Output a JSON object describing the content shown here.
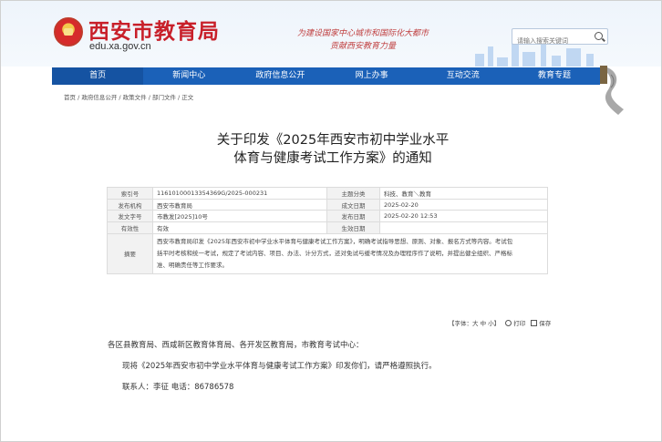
{
  "header": {
    "site_title": "西安市教育局",
    "site_domain": "edu.xa.gov.cn",
    "slogan_line1": "为建设国家中心城市和国际化大都市",
    "slogan_line2": "贡献西安教育力量",
    "search_placeholder": "请输入搜索关键词"
  },
  "nav": {
    "items": [
      "首页",
      "新闻中心",
      "政府信息公开",
      "网上办事",
      "互动交流",
      "教育专题"
    ]
  },
  "breadcrumb": "首页 / 政府信息公开 / 政策文件 / 部门文件 / 正文",
  "article": {
    "title_line1": "关于印发《2025年西安市初中学业水平",
    "title_line2": "体育与健康考试工作方案》的通知"
  },
  "meta": {
    "index_label": "索引号",
    "index_value": "11610100013354369G/2025-000231",
    "topic_label": "主题分类",
    "topic_value": "科技、教育＼教育",
    "publisher_label": "发布机构",
    "publisher_value": "西安市教育局",
    "created_label": "成文日期",
    "created_value": "2025-02-20",
    "docno_label": "发文字号",
    "docno_value": "市教发[2025]10号",
    "pubdate_label": "发布日期",
    "pubdate_value": "2025-02-20 12:53",
    "validity_label": "有效性",
    "validity_value": "有效",
    "effective_label": "生效日期",
    "effective_value": "",
    "abstract_label": "摘要",
    "abstract_line1": "西安市教育局印发《2025年西安市初中学业水平体育与健康考试工作方案》，明确考试指导思想、原则、对象、报名方式等内容。考试包",
    "abstract_line2": "括平时考核和统一考试，规定了考试内容、项目、办法、计分方式，还对免试与缓考情况及办理程序作了说明，并提出健全组织、严格标",
    "abstract_line3": "准、明确责任等工作要求。"
  },
  "tools": {
    "font_label": "【字体：大 中 小】",
    "print_label": "打印",
    "save_label": "保存"
  },
  "body": {
    "salutation": "各区县教育局、西咸新区教育体育局、各开发区教育局，市教育考试中心：",
    "paragraph1": "现将《2025年西安市初中学业水平体育与健康考试工作方案》印发你们，请严格遵照执行。",
    "contact": "联系人：李征    电话：86786578"
  }
}
